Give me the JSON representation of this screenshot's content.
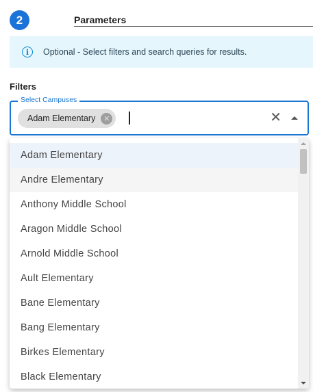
{
  "step": {
    "number": "2"
  },
  "parameters": {
    "title": "Parameters"
  },
  "info": {
    "icon": "info-icon",
    "text": "Optional - Select filters and search queries for results."
  },
  "filters": {
    "label": "Filters"
  },
  "select_campuses": {
    "legend": "Select Campuses",
    "chips": [
      {
        "label": "Adam Elementary"
      }
    ],
    "selected_option": "Adam Elementary",
    "hovered_option": "Andre Elementary",
    "options": [
      "Adam Elementary",
      "Andre Elementary",
      "Anthony Middle School",
      "Aragon Middle School",
      "Arnold Middle School",
      "Ault Elementary",
      "Bane Elementary",
      "Bang Elementary",
      "Birkes Elementary",
      "Black Elementary"
    ]
  },
  "colors": {
    "accent": "#1976d2",
    "badge": "#1a73d9",
    "info_background": "#e5f6fd",
    "info_icon": "#0288d1"
  }
}
